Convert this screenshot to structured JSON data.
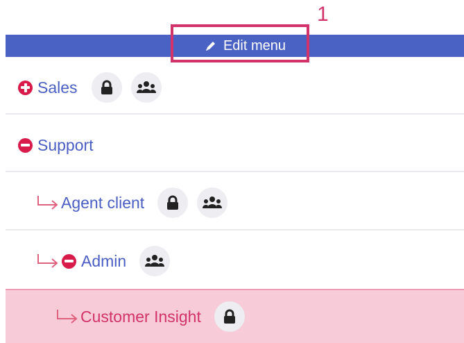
{
  "toolbar": {
    "edit_menu_label": "Edit menu",
    "annotation_number": "1"
  },
  "menu_items": [
    {
      "label": "Sales",
      "level": 0,
      "state_icon": "plus-circle-icon",
      "badges": [
        "lock-icon",
        "group-icon"
      ]
    },
    {
      "label": "Support",
      "level": 0,
      "state_icon": "minus-circle-icon",
      "badges": []
    },
    {
      "label": "Agent client",
      "level": 1,
      "state_icon": "child-arrow-icon",
      "badges": [
        "lock-icon",
        "group-icon"
      ]
    },
    {
      "label": "Admin",
      "level": 1,
      "state_icon": "minus-circle-icon",
      "badges": [
        "group-icon"
      ]
    },
    {
      "label": "Customer Insight",
      "level": 2,
      "state_icon": "child-arrow-icon",
      "badges": [
        "lock-icon"
      ],
      "selected": true
    }
  ],
  "colors": {
    "top_bar": "#4a62c4",
    "link_text": "#4a5ec3",
    "accent_red": "#d81b4a",
    "annotation": "#d2336b",
    "selected_row_bg": "#f7cbd7",
    "chip_bg": "#ededf2"
  }
}
